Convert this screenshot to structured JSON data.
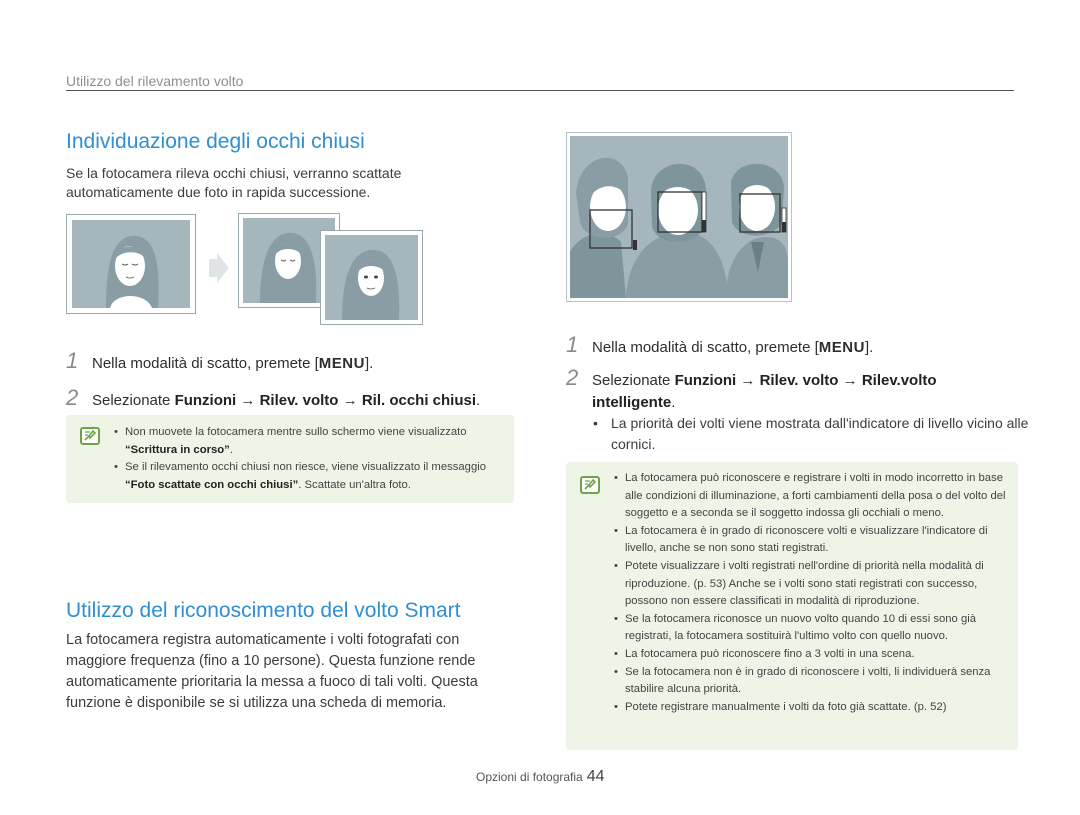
{
  "header": {
    "section": "Utilizzo del rilevamento volto"
  },
  "left": {
    "blink": {
      "title": "Individuazione degli occhi chiusi",
      "intro": "Se la fotocamera rileva occhi chiusi, verranno scattate automaticamente due foto in rapida successione.",
      "step1": {
        "num": "1",
        "text": "Nella modalità di scatto, premete [",
        "key": "MENU",
        "end": "]."
      },
      "step2": {
        "num": "2",
        "prefix": "Selezionate ",
        "item1": "Funzioni",
        "arrow": "→",
        "item2": "Rilev. volto",
        "item3": "Ril. occhi chiusi",
        "end": "."
      },
      "note": {
        "b1_pre": "Non muovete la fotocamera mentre sullo schermo viene visualizzato",
        "b1_quote": "“Scrittura in corso”",
        "b1_end": ".",
        "b2_pre": "Se il rilevamento occhi chiusi non riesce, viene visualizzato il messaggio ",
        "b2_quote": "“Foto scattate con occhi chiusi”",
        "b2_end": ". Scattate un'altra foto."
      }
    },
    "smart": {
      "title": "Utilizzo del riconoscimento del volto Smart",
      "intro": "La fotocamera registra automaticamente i volti fotografati con maggiore frequenza (fino a 10 persone). Questa funzione rende automaticamente prioritaria la messa a fuoco di tali volti. Questa funzione è disponibile se si utilizza una scheda di memoria."
    }
  },
  "right": {
    "step1": {
      "num": "1",
      "text": "Nella modalità di scatto, premete [",
      "key": "MENU",
      "end": "]."
    },
    "step2": {
      "num": "2",
      "prefix": "Selezionate ",
      "item1": "Funzioni",
      "arrow": "→",
      "item2": "Rilev. volto",
      "item3": "Rilev.volto intelligente",
      "end": "."
    },
    "bullet": "La priorità dei volti viene mostrata dall'indicatore di livello vicino alle cornici.",
    "notes": [
      "La fotocamera può riconoscere e registrare i volti in modo incorretto in base alle condizioni di illuminazione, a forti cambiamenti della posa o del volto del soggetto e a seconda se il soggetto indossa gli occhiali o meno.",
      "La fotocamera è in grado di riconoscere volti e visualizzare l'indicatore di livello, anche se non sono stati registrati.",
      "Potete visualizzare i volti registrati nell'ordine di priorità nella modalità di riproduzione. (p. 53) Anche se i volti sono stati registrati con successo, possono non essere classificati in modalità di riproduzione.",
      "Se la fotocamera riconosce un nuovo volto quando 10 di essi sono già registrati, la fotocamera sostituirà l'ultimo volto con quello nuovo.",
      "La fotocamera può riconoscere fino a 3 volti in una scena.",
      "Se la fotocamera non è in grado di riconoscere i volti, li individuerà senza stabilire alcuna priorità.",
      "Potete registrare manualmente i volti da foto già scattate. (p. 52)"
    ]
  },
  "footer": {
    "label": "Opzioni di fotografia",
    "page": "44"
  },
  "colors": {
    "title_blue": "#2f8fd0",
    "note_bg": "#eef4e6",
    "note_icon": "#6fa34a",
    "photo_bg": "#a5b7bd"
  },
  "icons": {
    "note": "note-icon",
    "step_arrow": "arrow-right-icon"
  }
}
